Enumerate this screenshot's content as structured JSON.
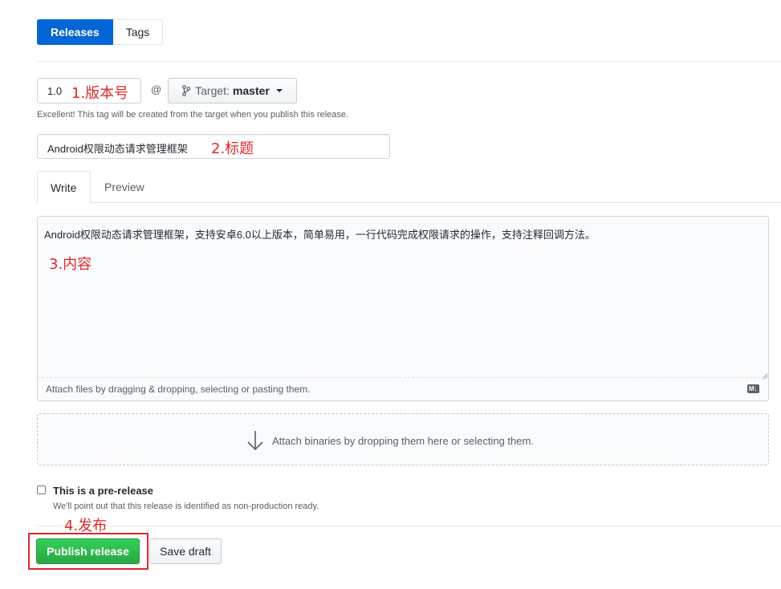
{
  "tabs": [
    {
      "label": "Releases",
      "selected": true
    },
    {
      "label": "Tags",
      "selected": false
    }
  ],
  "tag": {
    "value": "1.0",
    "annotation": "1.版本号",
    "at_symbol": "@",
    "target_label": "Target:",
    "target_branch": "master",
    "note": "Excellent! This tag will be created from the target when you publish this release."
  },
  "title_field": {
    "value": "Android权限动态请求管理框架",
    "annotation": "2.标题"
  },
  "editor": {
    "tabs": [
      "Write",
      "Preview"
    ],
    "content": "Android权限动态请求管理框架，支持安卓6.0以上版本，简单易用，一行代码完成权限请求的操作，支持注释回调方法。",
    "annotation": "3.内容",
    "attach_hint": "Attach files by dragging & dropping, selecting or pasting them.",
    "markdown_badge": "M↓"
  },
  "binaries": {
    "text": "Attach binaries by dropping them here or selecting them."
  },
  "prerelease": {
    "checked": false,
    "label": "This is a pre-release",
    "note": "We'll point out that this release is identified as non-production ready."
  },
  "actions": {
    "annotation": "4.发布",
    "publish_label": "Publish release",
    "draft_label": "Save draft"
  },
  "colors": {
    "primary_blue": "#0366d6",
    "publish_green": "#28a745",
    "annotation_red": "#e0282b"
  }
}
